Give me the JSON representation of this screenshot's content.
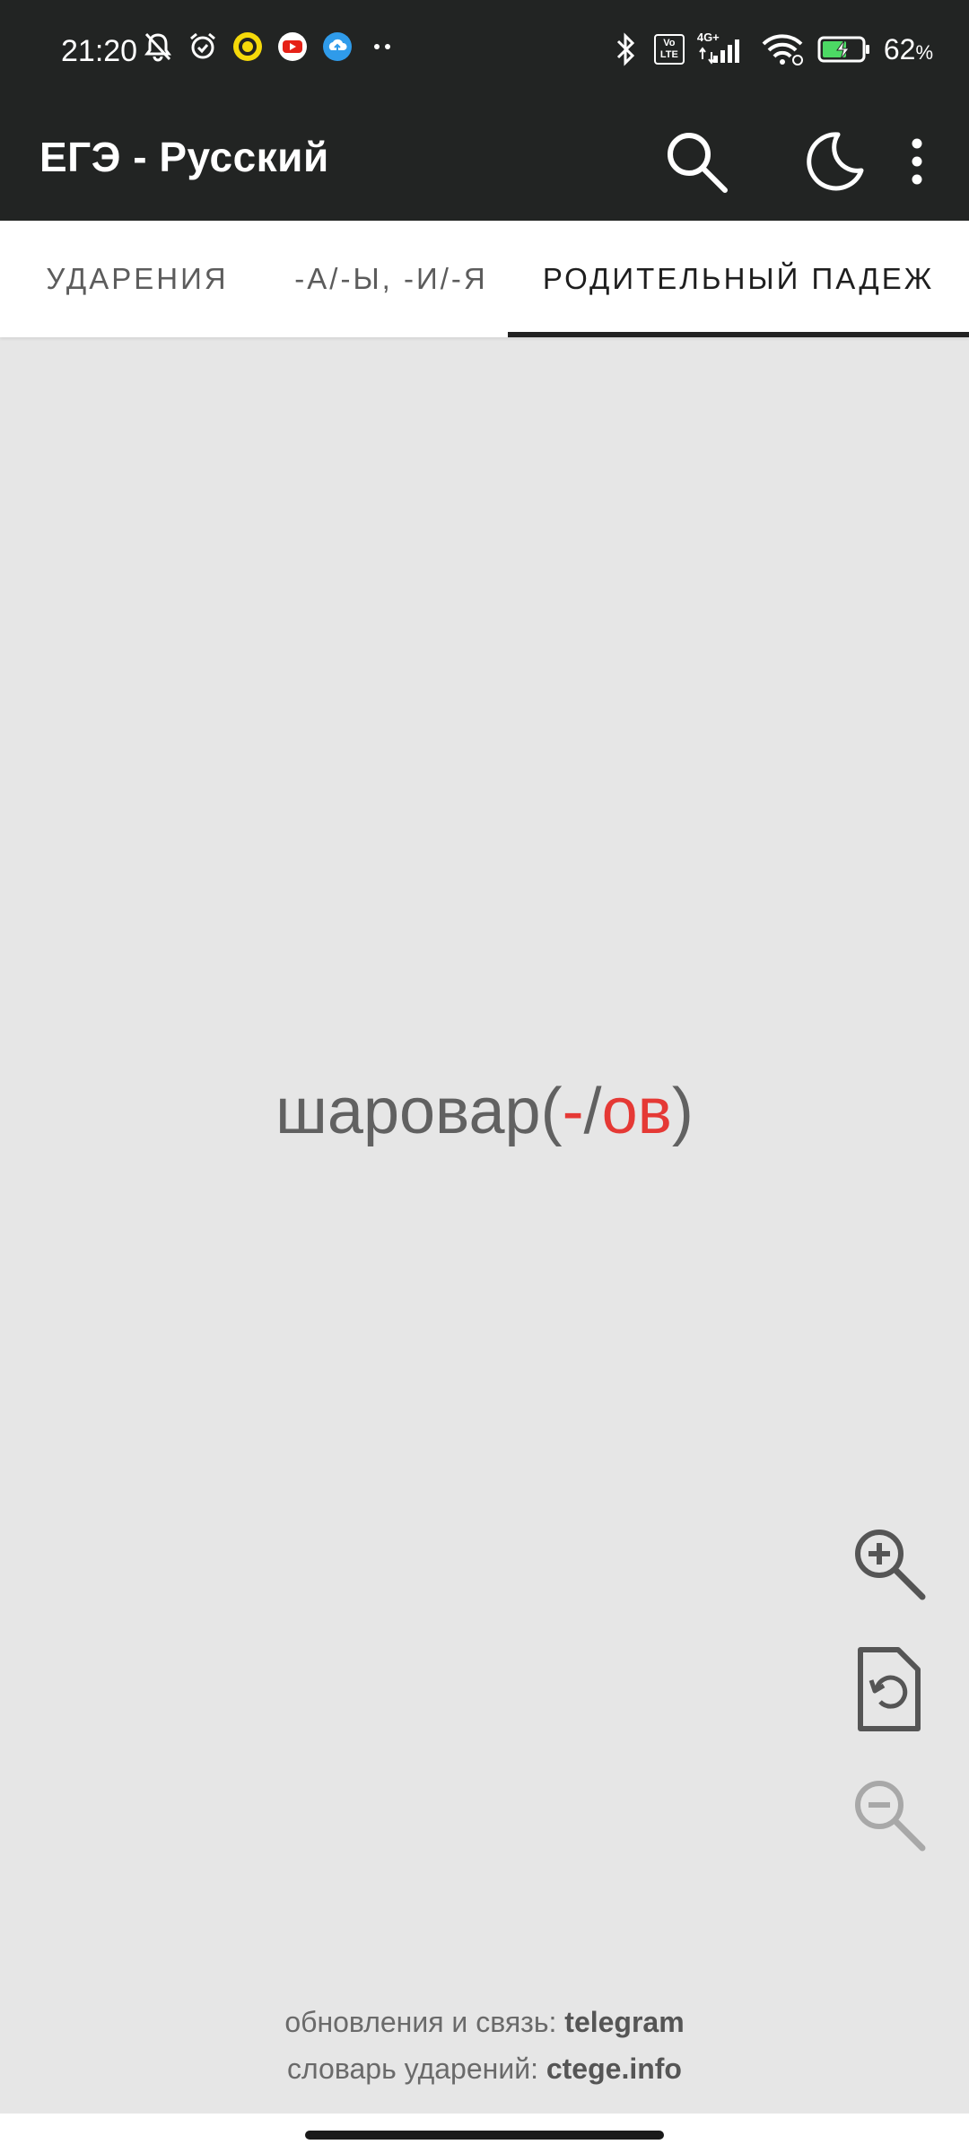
{
  "status_bar": {
    "time": "21:20",
    "left_icons": [
      "bell-off-icon",
      "alarm-icon",
      "yellow-app-icon",
      "youtube-icon",
      "cloud-upload-icon",
      "more-dots-icon"
    ],
    "right_icons": [
      "bluetooth-icon",
      "volte-icon",
      "signal-4g-icon",
      "wifi-icon",
      "battery-charging-icon"
    ],
    "network": "4G+",
    "volte": "Vo LTE",
    "battery_percent": "62",
    "battery_unit": "%"
  },
  "app_bar": {
    "title": "ЕГЭ - Русский",
    "actions": [
      "search-icon",
      "dark-mode-moon-icon",
      "overflow-menu-icon"
    ]
  },
  "tabs": [
    {
      "label": "УДАРЕНИЯ",
      "selected": false
    },
    {
      "label": "-А/-Ы, -И/-Я",
      "selected": false
    },
    {
      "label": "РОДИТЕЛЬНЫЙ ПАДЕЖ",
      "selected": true
    }
  ],
  "card": {
    "word_prefix": "шаровар(",
    "option_wrong": "-",
    "separator": "/",
    "option_correct": "ов",
    "word_suffix": ")"
  },
  "controls": [
    "zoom-in-icon",
    "reset-icon",
    "zoom-out-icon"
  ],
  "footer": {
    "line1_text": "обновления и связь: ",
    "line1_link": "telegram",
    "line2_text": "словарь ударений: ",
    "line2_link": "ctege.info"
  },
  "colors": {
    "app_bar": "#222423",
    "background": "#e6e6e6",
    "accent_red": "#e53935",
    "tab_indicator": "#222222"
  }
}
